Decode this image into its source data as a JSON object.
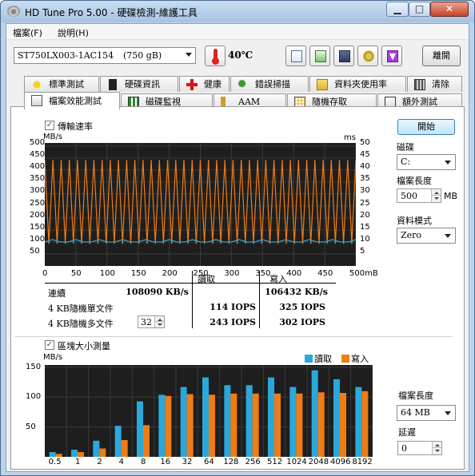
{
  "window": {
    "title": "HD Tune Pro  5.00 - 硬碟檢測-維護工具"
  },
  "menu": [
    {
      "label": "檔案(F)"
    },
    {
      "label": "說明(H)"
    }
  ],
  "toolbar": {
    "drive": {
      "name": "ST750LX003-1AC154",
      "size": "(750 gB)"
    },
    "temperature": "40℃",
    "exit_label": "離開",
    "icons": [
      "copy-icon",
      "copy-all-icon",
      "save-icon",
      "options-icon",
      "download-icon"
    ]
  },
  "tabs": {
    "row1": [
      {
        "label": "標準測試",
        "icon": "benchmark-icon"
      },
      {
        "label": "硬碟資訊",
        "icon": "info-icon"
      },
      {
        "label": "健康",
        "icon": "health-icon"
      },
      {
        "label": "錯誤掃描",
        "icon": "scan-icon"
      },
      {
        "label": "資料夾使用率",
        "icon": "folder-icon"
      },
      {
        "label": "清除",
        "icon": "trash-icon"
      }
    ],
    "row2": [
      {
        "label": "檔案效能測試",
        "icon": "file-benchmark-icon",
        "active": true
      },
      {
        "label": "磁碟監視",
        "icon": "monitor-icon"
      },
      {
        "label": "AAM",
        "icon": "speaker-icon"
      },
      {
        "label": "隨機存取",
        "icon": "random-access-icon"
      },
      {
        "label": "額外測試",
        "icon": "extra-tests-icon"
      }
    ]
  },
  "transfer": {
    "checkbox_label": "傳輸速率",
    "checked": true,
    "left_unit": "MB/s",
    "right_unit": "ms",
    "y_ticks": [
      "500",
      "450",
      "400",
      "350",
      "300",
      "250",
      "200",
      "150",
      "100",
      "50"
    ],
    "y_right_ticks": [
      "50",
      "45",
      "40",
      "35",
      "30",
      "25",
      "20",
      "15",
      "10",
      "5"
    ],
    "x_ticks": [
      "0",
      "50",
      "100",
      "150",
      "200",
      "250",
      "300",
      "350",
      "400",
      "450",
      "500mB"
    ],
    "start_label": "開始",
    "disk_label": "磁碟",
    "disk_value": "C:",
    "file_length_label": "檔案長度",
    "file_length_value": "500",
    "file_length_unit": "MB",
    "data_pattern_label": "資料模式",
    "data_pattern_value": "Zero"
  },
  "results": {
    "read_header": "讀取",
    "write_header": "寫入",
    "rows": [
      {
        "label": "連續",
        "read": "108090 KB/s",
        "write": "106432 KB/s"
      },
      {
        "label": "4 KB隨機單文件",
        "read": "114 IOPS",
        "write": "325 IOPS"
      },
      {
        "label": "4 KB隨機多文件",
        "queue": "32",
        "read": "243 IOPS",
        "write": "302 IOPS"
      }
    ]
  },
  "block": {
    "checkbox_label": "區塊大小測量",
    "checked": true,
    "unit": "MB/s",
    "legend_read": "讀取",
    "legend_write": "寫入",
    "file_length_label": "檔案長度",
    "file_length_value": "64 MB",
    "delay_label": "延遲",
    "delay_value": "0"
  },
  "colors": {
    "read": "#2aa8dc",
    "write": "#f07c14",
    "chart_bg": "#1e1e1e"
  },
  "chart_data": [
    {
      "type": "line",
      "xlabel": "",
      "ylabel": "MB/s",
      "x_range": [
        0,
        500
      ],
      "ylim": [
        0,
        500
      ],
      "y2lim": [
        0,
        50
      ],
      "grid": true,
      "series": [
        {
          "name": "",
          "axis": "left",
          "values": [
            440,
            95,
            440,
            95,
            440,
            95,
            440,
            95,
            440,
            95,
            440,
            95,
            440,
            95,
            440,
            95,
            440,
            95,
            440,
            95,
            440,
            95,
            440,
            95,
            440,
            95,
            440,
            95,
            440,
            95,
            440,
            95,
            440,
            95,
            440,
            95,
            440,
            95,
            440,
            95,
            440,
            95,
            440,
            95,
            440,
            95,
            440,
            95,
            440,
            95,
            440,
            95,
            440,
            95,
            440,
            95,
            440,
            95,
            440,
            95,
            440,
            95,
            440,
            95,
            440,
            95,
            440,
            95,
            440,
            95,
            440,
            95,
            440,
            95,
            440,
            95,
            440
          ]
        },
        {
          "name": "",
          "axis": "right",
          "values": [
            10,
            11,
            10,
            10,
            11,
            10,
            10,
            11,
            10,
            10,
            11,
            10,
            10,
            11,
            10,
            10,
            11,
            10,
            10,
            11,
            10,
            10,
            11,
            10,
            10,
            11,
            10,
            10,
            11,
            10,
            10,
            11,
            10,
            10,
            11,
            10,
            10,
            11,
            10,
            10,
            11
          ]
        }
      ]
    },
    {
      "type": "bar",
      "ylabel": "MB/s",
      "ylim": [
        0,
        150
      ],
      "y_ticks": [
        "150",
        "100",
        "50"
      ],
      "categories": [
        "0.5",
        "1",
        "2",
        "4",
        "8",
        "16",
        "32",
        "64",
        "128",
        "256",
        "512",
        "1024",
        "2048",
        "4096",
        "8192"
      ],
      "series": [
        {
          "name": "讀取",
          "values": [
            8,
            12,
            27,
            52,
            93,
            104,
            117,
            133,
            120,
            120,
            133,
            117,
            145,
            130,
            117
          ]
        },
        {
          "name": "寫入",
          "values": [
            5,
            8,
            14,
            28,
            53,
            102,
            105,
            104,
            106,
            106,
            106,
            106,
            108,
            107,
            110
          ]
        }
      ]
    }
  ]
}
